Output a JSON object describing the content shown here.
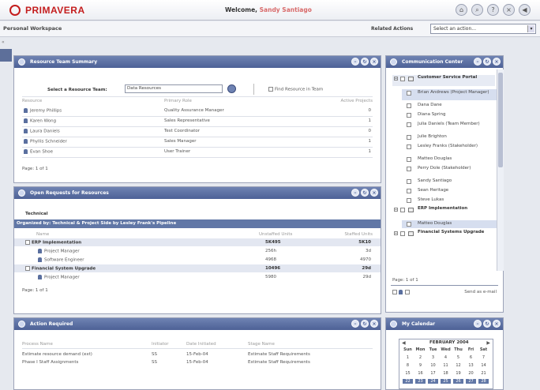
{
  "header": {
    "logo_text": "PRIMAVERA",
    "welcome_prefix": "Welcome,",
    "user_name": "Sandy Santiago",
    "icons": [
      "home-icon",
      "search-icon",
      "help-icon",
      "close-icon",
      "logout-icon"
    ]
  },
  "subheader": {
    "title": "Personal Workspace",
    "related_label": "Related Actions",
    "related_value": "Select an action..."
  },
  "resource_team": {
    "title": "Resource Team Summary",
    "select_label": "Select a Resource Team:",
    "select_value": "Data Resources",
    "find_label": "Find Resource in Team",
    "columns": [
      "Resource",
      "Primary Role",
      "Active Projects"
    ],
    "rows": [
      {
        "name": "Jeremy Phillips",
        "role": "Quality Assurance Manager",
        "count": "0"
      },
      {
        "name": "Karen Wong",
        "role": "Sales Representative",
        "count": "1"
      },
      {
        "name": "Laura Daniels",
        "role": "Test Coordinator",
        "count": "0"
      },
      {
        "name": "Phyllis Schneider",
        "role": "Sales Manager",
        "count": "1"
      },
      {
        "name": "Evan Shoe",
        "role": "User Trainer",
        "count": "1"
      }
    ],
    "page": "Page: 1 of 1"
  },
  "open_requests": {
    "title": "Open Requests for Resources",
    "subtitle": "Technical",
    "band": "Organized by: Technical & Project Side by Lesley Frank's Pipeline",
    "columns": [
      "Name",
      "Unstaffed Units",
      "Staffed Units"
    ],
    "rows": [
      {
        "name": "ERP Implementation",
        "a": "5K495",
        "b": "5K10",
        "bold": true,
        "indent": false
      },
      {
        "name": "Project Manager",
        "a": "256h",
        "b": "3d",
        "bold": false,
        "indent": true
      },
      {
        "name": "Software Engineer",
        "a": "4968",
        "b": "4970",
        "bold": false,
        "indent": true
      },
      {
        "name": "Financial System Upgrade",
        "a": "10496",
        "b": "29d",
        "bold": true,
        "indent": false
      },
      {
        "name": "Project Manager",
        "a": "5980",
        "b": "29d",
        "bold": false,
        "indent": true
      }
    ],
    "page": "Page: 1 of 1"
  },
  "action_required": {
    "title": "Action Required",
    "columns": [
      "Process Name",
      "Initiator",
      "Date Initiated",
      "Stage Name"
    ],
    "rows": [
      {
        "process": "Estimate resource demand (ext)",
        "initiator": "SS",
        "date": "15-Feb-04",
        "stage": "Estimate Staff Requirements"
      },
      {
        "process": "Phase I Staff Assignments",
        "initiator": "SS",
        "date": "15-Feb-04",
        "stage": "Estimate Staff Requirements"
      }
    ]
  },
  "communication": {
    "title": "Communication Center",
    "groups": [
      {
        "name": "Customer Service Portal",
        "members": [
          "Brian Andrews (Project Manager)",
          "Dana Dane",
          "Diana Spring",
          "Julia Daniels (Team Member)",
          "Julie Brighton",
          "Lesley Franks (Stakeholder)",
          "Matteo Douglas",
          "Perry Dole (Stakeholder)",
          "Sandy Santiago",
          "Sean Heritage",
          "Steve Lukas"
        ]
      },
      {
        "name": "ERP Implementation",
        "members": [
          "Matteo Douglas"
        ]
      },
      {
        "name": "Financial Systems Upgrade",
        "members": []
      }
    ],
    "page": "Page: 1 of 1",
    "send": "Send as e-mail"
  },
  "calendar": {
    "title": "My Calendar",
    "month": "FEBRUARY 2004",
    "days": [
      "Sun",
      "Mon",
      "Tue",
      "Wed",
      "Thu",
      "Fri",
      "Sat"
    ],
    "weeks": [
      [
        "1",
        "2",
        "3",
        "4",
        "5",
        "6",
        "7"
      ],
      [
        "8",
        "9",
        "10",
        "11",
        "12",
        "13",
        "14"
      ],
      [
        "15",
        "16",
        "17",
        "18",
        "19",
        "20",
        "21"
      ],
      [
        "22",
        "23",
        "24",
        "25",
        "26",
        "27",
        "28"
      ]
    ]
  }
}
